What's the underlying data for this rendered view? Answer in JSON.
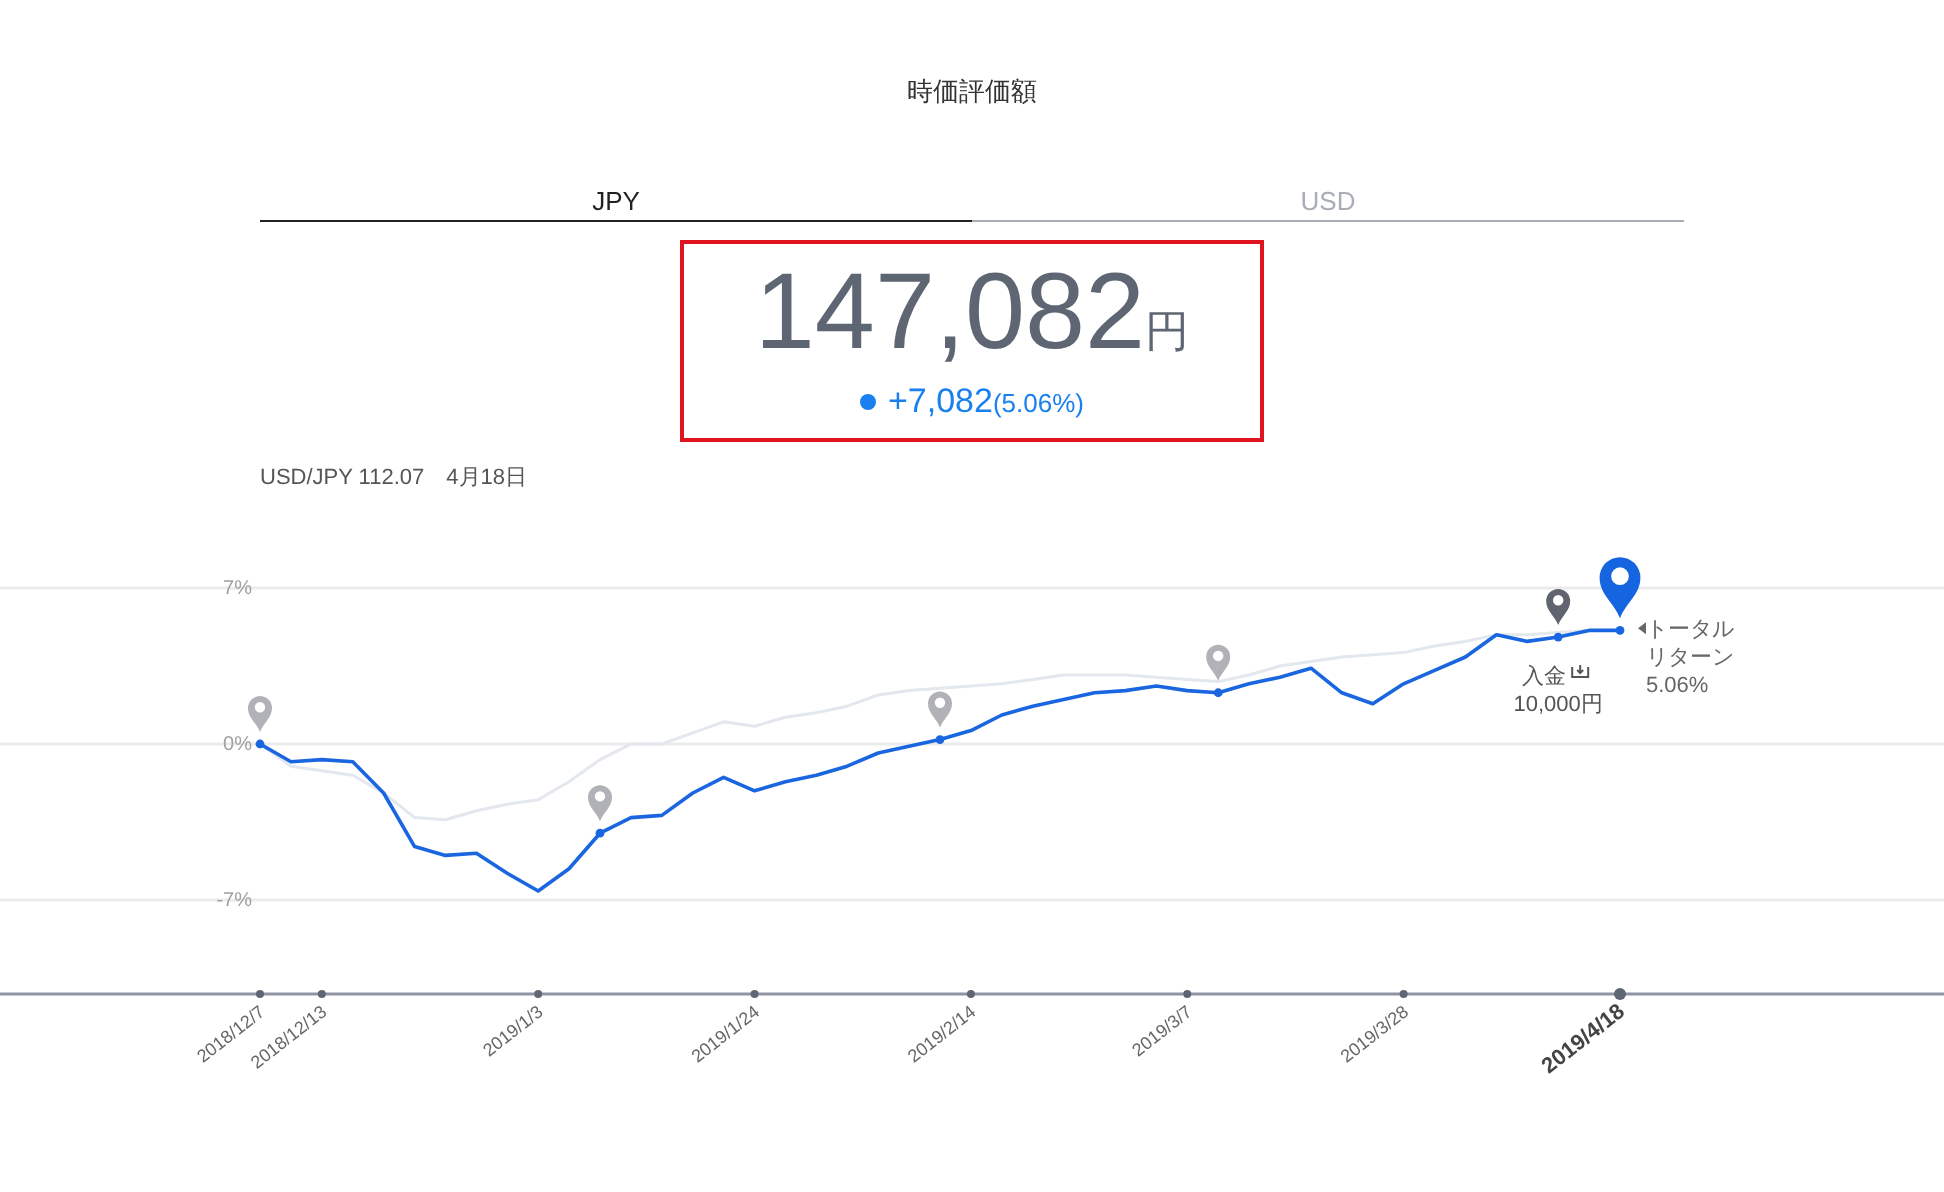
{
  "title": "時価評価額",
  "tabs": [
    {
      "label": "JPY",
      "selected": true
    },
    {
      "label": "USD",
      "selected": false
    }
  ],
  "valuation": {
    "amount": "147,082",
    "unit": "円",
    "change": "+7,082",
    "change_percent": "(5.06%)"
  },
  "rate_line": "USD/JPY 112.07　4月18日",
  "chart": {
    "chart_data": {
      "type": "line",
      "categories": [
        "2018/12/7",
        null,
        "2018/12/13",
        null,
        null,
        null,
        null,
        null,
        null,
        "2019/1/3",
        null,
        null,
        null,
        null,
        null,
        null,
        "2019/1/24",
        null,
        null,
        null,
        null,
        null,
        null,
        "2019/2/14",
        null,
        null,
        null,
        null,
        null,
        null,
        "2019/3/7",
        null,
        null,
        null,
        null,
        null,
        null,
        "2019/3/28",
        null,
        null,
        null,
        null,
        null,
        null,
        "2019/4/18"
      ],
      "series": [
        {
          "color": "#1a66e0",
          "values": [
            0,
            -0.8,
            -0.7,
            -0.8,
            -2.2,
            -4.6,
            -5.0,
            -4.9,
            -5.8,
            -6.6,
            -5.6,
            -4.0,
            -3.3,
            -3.2,
            -2.2,
            -1.5,
            -2.1,
            -1.7,
            -1.4,
            -1.0,
            -0.4,
            -0.1,
            0.2,
            0.6,
            1.3,
            1.7,
            2.0,
            2.3,
            2.4,
            2.6,
            2.4,
            2.3,
            2.7,
            3.0,
            3.4,
            2.3,
            1.8,
            2.7,
            3.3,
            3.9,
            4.9,
            4.6,
            4.8,
            5.1,
            5.1
          ]
        },
        {
          "color": "#e3e7ee",
          "values": [
            0,
            -1.0,
            -1.2,
            -1.4,
            -2.2,
            -3.3,
            -3.4,
            -3.0,
            -2.7,
            -2.5,
            -1.7,
            -0.7,
            0,
            0,
            0.5,
            1.0,
            0.8,
            1.2,
            1.4,
            1.7,
            2.2,
            2.4,
            2.5,
            2.6,
            2.7,
            2.9,
            3.1,
            3.1,
            3.1,
            3.0,
            2.9,
            2.8,
            3.1,
            3.5,
            3.7,
            3.9,
            4.0,
            4.1,
            4.4,
            4.6,
            4.9,
            4.9,
            5.0,
            5.1,
            null
          ]
        }
      ],
      "ylim": [
        -7,
        7
      ],
      "yticks": [
        {
          "value": 7,
          "label": "7%"
        },
        {
          "value": 0,
          "label": "0%"
        },
        {
          "value": -7,
          "label": "-7%"
        }
      ],
      "annotations": [
        {
          "text": "入金"
        },
        {
          "text": "10,000円"
        },
        {
          "text": "トータルリターン"
        },
        {
          "text": "5.06%"
        }
      ]
    },
    "markers": [
      {
        "kind": "past"
      },
      {
        "kind": "past"
      },
      {
        "kind": "past"
      },
      {
        "kind": "past"
      },
      {
        "kind": "deposit"
      },
      {
        "kind": "current"
      }
    ],
    "date_axis": [
      {
        "selected": false
      },
      {
        "selected": false
      },
      {
        "selected": false
      },
      {
        "selected": false
      },
      {
        "selected": false
      },
      {
        "selected": false
      },
      {
        "selected": false
      },
      {
        "selected": true
      }
    ]
  }
}
